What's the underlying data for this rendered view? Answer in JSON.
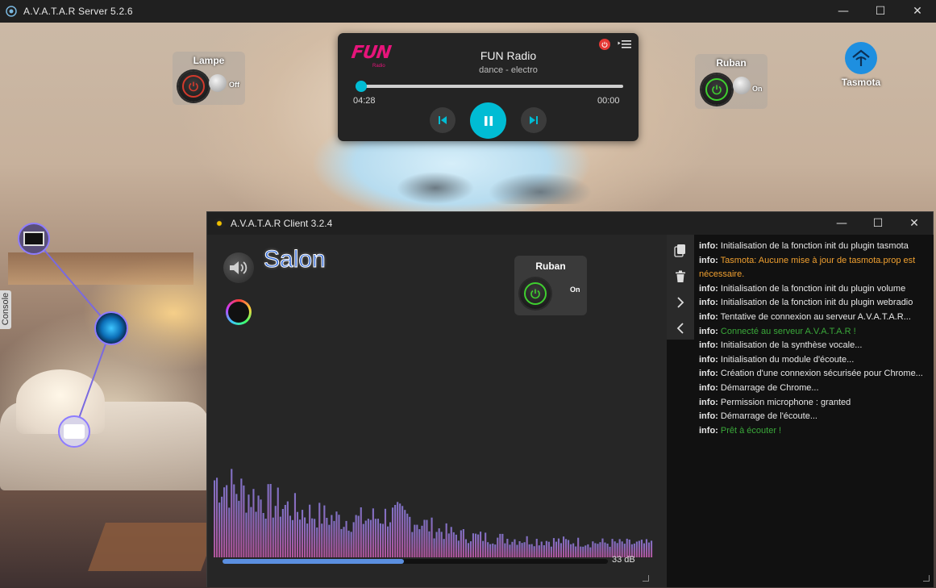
{
  "server_window": {
    "title": "A.V.A.T.A.R Server 5.2.6",
    "controls": {
      "minimize": "—",
      "maximize": "☐",
      "close": "✕"
    }
  },
  "widgets": {
    "lampe": {
      "label": "Lampe",
      "state": "Off"
    },
    "ruban_server": {
      "label": "Ruban",
      "state": "On"
    },
    "tasmota": {
      "label": "Tasmota"
    }
  },
  "player": {
    "logo_text": "FUN",
    "logo_sub": "Radio",
    "station": "FUN Radio",
    "genre": "dance - electro",
    "elapsed": "04:28",
    "remaining": "00:00",
    "progress": 0.02
  },
  "console_tab": {
    "label": "Console"
  },
  "client_window": {
    "title": "A.V.A.T.A.R Client 3.2.4",
    "controls": {
      "minimize": "—",
      "maximize": "☐",
      "close": "✕"
    },
    "room": "Salon",
    "ruban": {
      "label": "Ruban",
      "state": "On"
    },
    "volume_db": "33 dB",
    "volume_level": 0.47
  },
  "log": {
    "lines": [
      {
        "prefix": "info:",
        "text": " Initialisation de la fonction init du plugin tasmota",
        "color": "#e8e8e8"
      },
      {
        "prefix": "info:",
        "text": " Tasmota: Aucune mise à jour de tasmota.prop est nécessaire.",
        "color": "#f0a030",
        "wrap": true
      },
      {
        "prefix": "info:",
        "text": " Initialisation de la fonction init du plugin volume",
        "color": "#e8e8e8"
      },
      {
        "prefix": "info:",
        "text": " Initialisation de la fonction init du plugin webradio",
        "color": "#e8e8e8"
      },
      {
        "prefix": "info:",
        "text": " Tentative de connexion au serveur A.V.A.T.A.R...",
        "color": "#e8e8e8"
      },
      {
        "prefix": "info:",
        "text": " Connecté au serveur A.V.A.T.A.R !",
        "color": "#3aa83a"
      },
      {
        "prefix": "info:",
        "text": " Initialisation de la synthèse vocale...",
        "color": "#e8e8e8"
      },
      {
        "prefix": "info:",
        "text": " Initialisation du module d'écoute...",
        "color": "#e8e8e8"
      },
      {
        "prefix": "info:",
        "text": " Création d'une connexion sécurisée pour Chrome...",
        "color": "#e8e8e8"
      },
      {
        "prefix": "info:",
        "text": " Démarrage de Chrome...",
        "color": "#e8e8e8"
      },
      {
        "prefix": "info:",
        "text": " Permission microphone : granted",
        "color": "#e8e8e8"
      },
      {
        "prefix": "info:",
        "text": " Démarrage de l'écoute...",
        "color": "#e8e8e8"
      },
      {
        "prefix": "info:",
        "text": " Prêt à écouter !",
        "color": "#3aa83a"
      }
    ]
  },
  "colors": {
    "accent_cyan": "#00bcd4",
    "power_on_green": "#3fcf2f",
    "power_off_red": "#d33a2c",
    "spectrum_top": "#8a7ad8",
    "spectrum_bottom": "#c05aa8",
    "volume_bar": "#5b8fe0"
  },
  "icons": {
    "app": "avatar-server-icon",
    "client_app": "avatar-client-icon",
    "power": "power-icon",
    "prev": "skip-previous-icon",
    "pause": "pause-icon",
    "next": "skip-next-icon",
    "playlist": "playlist-icon",
    "copy": "copy-icon",
    "trash": "trash-icon",
    "expand": "chevron-right-icon",
    "collapse": "chevron-left-icon",
    "speaker": "speaker-icon",
    "tasmota": "tasmota-icon",
    "radio_badge": "radio-badge-icon"
  }
}
